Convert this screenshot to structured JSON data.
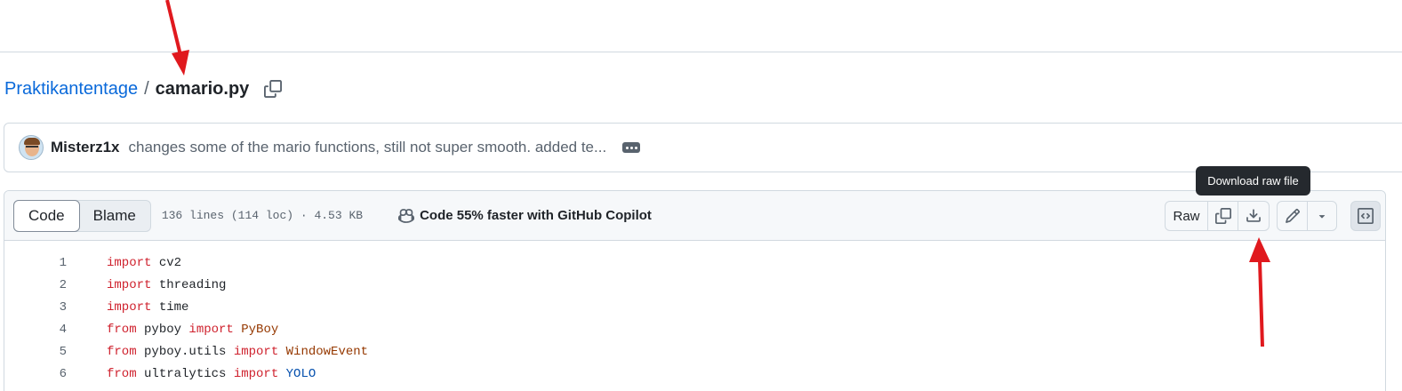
{
  "breadcrumb": {
    "repo": "Praktikantentage",
    "separator": "/",
    "file": "camario.py"
  },
  "commit": {
    "author": "Misterz1x",
    "message": "changes some of the mario functions, still not super smooth. added te..."
  },
  "file_header": {
    "tabs": [
      {
        "label": "Code",
        "active": true
      },
      {
        "label": "Blame",
        "active": false
      }
    ],
    "meta": "136 lines (114 loc) · 4.53 KB",
    "copilot_label": "Code 55% faster with GitHub Copilot",
    "raw_label": "Raw",
    "tooltip": "Download raw file"
  },
  "code": {
    "line_numbers": [
      "1",
      "2",
      "3",
      "4",
      "5",
      "6"
    ],
    "lines": [
      [
        {
          "t": "import",
          "c": "kw"
        },
        {
          "t": " cv2",
          "c": ""
        }
      ],
      [
        {
          "t": "import",
          "c": "kw"
        },
        {
          "t": " threading",
          "c": ""
        }
      ],
      [
        {
          "t": "import",
          "c": "kw"
        },
        {
          "t": " time",
          "c": ""
        }
      ],
      [
        {
          "t": "from",
          "c": "kw"
        },
        {
          "t": " pyboy ",
          "c": ""
        },
        {
          "t": "import",
          "c": "kw"
        },
        {
          "t": " PyBoy",
          "c": "cls"
        }
      ],
      [
        {
          "t": "from",
          "c": "kw"
        },
        {
          "t": " pyboy.utils ",
          "c": ""
        },
        {
          "t": "import",
          "c": "kw"
        },
        {
          "t": " WindowEvent",
          "c": "cls"
        }
      ],
      [
        {
          "t": "from",
          "c": "kw"
        },
        {
          "t": " ultralytics ",
          "c": ""
        },
        {
          "t": "import",
          "c": "kw"
        },
        {
          "t": " YOLO",
          "c": "cls2"
        }
      ]
    ]
  },
  "colors": {
    "link": "#0969da",
    "keyword": "#cf222e",
    "annotation_arrow": "#e0191e"
  },
  "icons": [
    "copy-icon",
    "kebab-horizontal-icon",
    "copilot-icon",
    "download-icon",
    "pencil-icon",
    "triangle-down-icon",
    "code-square-icon"
  ]
}
